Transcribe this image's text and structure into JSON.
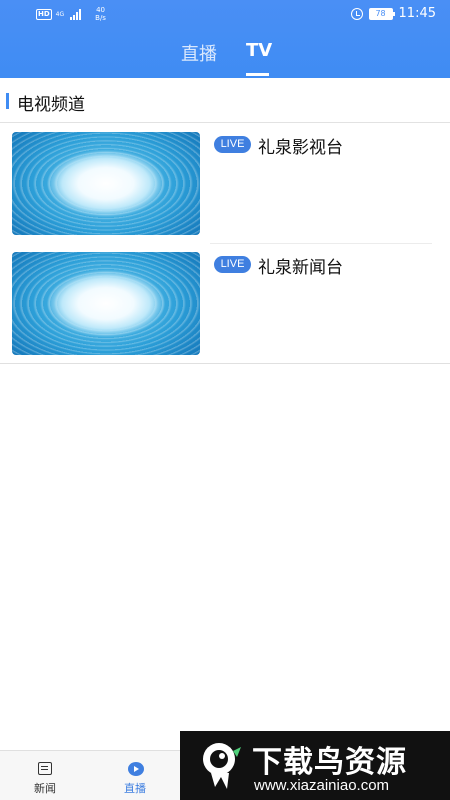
{
  "status_bar": {
    "network_badge": "HD",
    "net_type": "4G",
    "net_speed_value": "40",
    "net_speed_unit": "B/s",
    "battery": "78",
    "time": "11:45"
  },
  "tabs": [
    {
      "label": "直播",
      "active": false
    },
    {
      "label": "TV",
      "active": true
    }
  ],
  "section": {
    "title": "电视频道"
  },
  "channels": [
    {
      "badge": "LIVE",
      "name": "礼泉影视台"
    },
    {
      "badge": "LIVE",
      "name": "礼泉新闻台"
    }
  ],
  "bottom_nav": [
    {
      "label": "新闻",
      "icon": "news-icon",
      "active": false
    },
    {
      "label": "直播",
      "icon": "play-icon",
      "active": true
    }
  ],
  "watermark": {
    "title": "下载鸟资源",
    "url": "www.xiazainiao.com"
  },
  "colors": {
    "accent": "#3f8cf3",
    "live_badge": "#3f7fe0"
  }
}
